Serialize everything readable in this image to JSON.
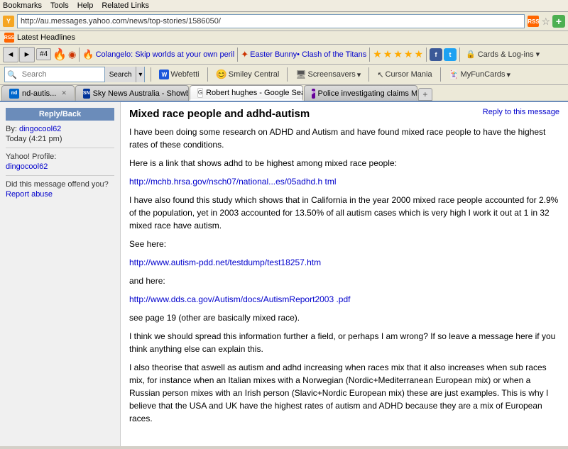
{
  "browser": {
    "menu_items": [
      "Bookmarks",
      "Tools",
      "Help",
      "Related Links"
    ],
    "address": "http://au.messages.yahoo.com/news/top-stories/1586050/",
    "latest_headlines": "Latest Headlines",
    "toolbar_items": {
      "nav": [
        "◄",
        "►",
        "#4"
      ],
      "bookmarks": [
        {
          "label": "Colangelo: Skip worlds at your own peril",
          "icon": "fire"
        },
        {
          "label": "Easter Bunny• Clash of the Titans",
          "icon": "news"
        }
      ]
    },
    "search_bar": {
      "placeholder": "",
      "search_label": "Search",
      "webfetti_label": "Webfetti",
      "smiley_label": "Smiley Central",
      "screensavers_label": "Screensavers",
      "cursor_label": "Cursor Mania",
      "cards_label": "MyFunCards"
    },
    "tabs": [
      {
        "id": "adhd",
        "label": "nd-autis...",
        "active": false,
        "closable": true,
        "icon": "adhd"
      },
      {
        "id": "sky",
        "label": "Sky News Australia - Showbiz Article",
        "active": false,
        "closable": true,
        "icon": "sky"
      },
      {
        "id": "google",
        "label": "Robert hughes - Google Search",
        "active": true,
        "closable": true,
        "icon": "google"
      },
      {
        "id": "police",
        "label": "Police investigating claims Max Mar...",
        "active": false,
        "closable": true,
        "icon": "police"
      }
    ]
  },
  "left_panel": {
    "nav_title": "Reply/Back",
    "by_label": "By:",
    "author": "dingocool62",
    "date_label": "Today (4:21 pm)",
    "profile_label": "Yahoo! Profile:",
    "profile_name": "dingocool62",
    "offend_label": "Did this message offend you?",
    "report_label": "Report abuse"
  },
  "message": {
    "title": "Mixed race people and adhd-autism",
    "reply_link": "Reply to this message",
    "paragraphs": [
      "I have been doing some research on ADHD and Autism and have found mixed race people to have the highest rates of these conditions.",
      "Here is a link that shows adhd to be highest among mixed race people:",
      "http://mchb.hrsa.gov/nsch07/national...es/05adhd.h tml",
      "I have also found this study which shows that in California in the year 2000 mixed race people accounted for 2.9% of the population, yet in 2003 accounted for 13.50% of all autism cases which is very high I work it out at 1 in 32 mixed race have autism.",
      "See here:",
      "http://www.autism-pdd.net/testdump/test18257.htm",
      "and here:",
      "http://www.dds.ca.gov/Autism/docs/AutismReport2003 .pdf",
      "see page 19 (other are basically mixed race).",
      "I think we should spread this information further a field, or perhaps I am wrong? If so leave a message here if you think anything else can explain this.",
      "I also theorise that aswell as autism and adhd increasing when races mix that it also increases when sub races mix, for instance when an Italian mixes with a Norwegian (Nordic+Mediterranean European mix) or when a Russian person mixes with an Irish person (Slavic+Nordic European mix) these are just examples. This is why I believe that the USA and UK have the highest rates of autism and ADHD because they are a mix of European races."
    ]
  }
}
